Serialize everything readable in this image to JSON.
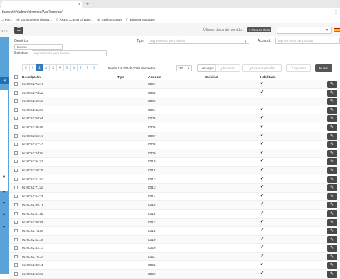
{
  "browser": {
    "tab_title": "",
    "new_tab": "+",
    "url": "baesruti/#/admin/elemnco/AppTeseiras/",
    "bookmarks": [
      {
        "icon": "folder-icon",
        "label": "Ra..."
      },
      {
        "icon": "globe-icon",
        "label": "Consortisimo di salu..."
      },
      {
        "icon": "document-icon",
        "label": "ÁREA CLIENTE | Ban..."
      },
      {
        "icon": "globe-icon",
        "label": "tracking conan"
      },
      {
        "icon": "document-icon",
        "label": "Disposal Manager"
      }
    ]
  },
  "sidebar": {
    "version": "2.2.1",
    "active_icon": "chevron-left-icon",
    "arrows": [
      "▼",
      "▼",
      "▼",
      "▼",
      "▼"
    ]
  },
  "header": {
    "menu_icon": "☰",
    "server_label": "Últimos datos del servidor:",
    "server_date": "27/01/2022 06:00",
    "select_caret": "▼"
  },
  "filters": {
    "generico_label": "Genérico",
    "generico_value": "Buscar",
    "tipo_label": "Tipo:",
    "tipo_placeholder": "Ingrese texto para buscar",
    "account_label": "Account:",
    "account_placeholder": "Ingrese texto para buscar",
    "solicitud_label": "Solicitud:",
    "solicitud_placeholder": "Ingrese texto para buscar",
    "caret": "▼"
  },
  "pagination": {
    "pages": [
      "«",
      "‹",
      "1",
      "2",
      "3",
      "4",
      "5",
      "6",
      "7",
      "›",
      "»"
    ],
    "active": "1",
    "info": "Desde 1 a 150 de 1000 elementos",
    "per_page": "150"
  },
  "actions": {
    "reload": "recargar",
    "export": "Exportar",
    "export_template": "Exportar plantilla",
    "import": "Importar",
    "new": "Nuevo",
    "edit_glyph": "✎",
    "check_glyph": "✔"
  },
  "table": {
    "columns": [
      "Descripción",
      "Tipo",
      "Account",
      "Solicitud",
      "Habilitado"
    ],
    "rows": [
      {
        "desc": "0d:00:62:7a:17",
        "account": "0001",
        "enabled": true
      },
      {
        "desc": "0d:00:62:7d:ad",
        "account": "0002",
        "enabled": true
      },
      {
        "desc": "0d:00:62:60:c8",
        "account": "0003",
        "enabled": false
      },
      {
        "desc": "0d:00:62:8a:9e",
        "account": "0004",
        "enabled": true
      },
      {
        "desc": "0d:00:62:8d:e5",
        "account": "0005",
        "enabled": true
      },
      {
        "desc": "0d:00:62:5b:80",
        "account": "0006",
        "enabled": true
      },
      {
        "desc": "0d:00:62:b2:17",
        "account": "0007",
        "enabled": true
      },
      {
        "desc": "0d:00:62:67:43",
        "account": "0008",
        "enabled": true
      },
      {
        "desc": "0d:00:62:7d:97",
        "account": "0009",
        "enabled": true
      },
      {
        "desc": "0d:00:62:9c:c3",
        "account": "0010",
        "enabled": true
      },
      {
        "desc": "0d:00:62:68:30",
        "account": "0011",
        "enabled": true
      },
      {
        "desc": "0d:00:62:51:62",
        "account": "0012",
        "enabled": true
      },
      {
        "desc": "0d:00:62:71:a7",
        "account": "0013",
        "enabled": true
      },
      {
        "desc": "0d:00:62:6a:76",
        "account": "0014",
        "enabled": true
      },
      {
        "desc": "0d:00:62:99:78",
        "account": "0015",
        "enabled": true
      },
      {
        "desc": "0d:00:62:b1:d2",
        "account": "0016",
        "enabled": true
      },
      {
        "desc": "0d:00:62:88:8f",
        "account": "0017",
        "enabled": true
      },
      {
        "desc": "0d:00:62:7a:c8",
        "account": "0018",
        "enabled": true
      },
      {
        "desc": "0d:00:62:52:39",
        "account": "0019",
        "enabled": true
      },
      {
        "desc": "0d:00:62:53:17",
        "account": "0020",
        "enabled": true
      },
      {
        "desc": "0d:00:62:76:24",
        "account": "0021",
        "enabled": true
      },
      {
        "desc": "0d:00:62:80:45",
        "account": "0022",
        "enabled": true
      },
      {
        "desc": "0d:00:62:52:9d",
        "account": "0023",
        "enabled": true
      }
    ]
  }
}
